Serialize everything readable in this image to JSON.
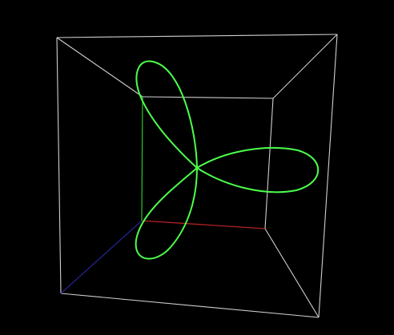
{
  "scene": {
    "background_color": "#000000",
    "box_edge_color": "#cfcfcf",
    "curve_color": "#4cff4c",
    "axes": {
      "x_color": "#b32222",
      "y_color": "#2cc82c",
      "z_color": "#22228f"
    },
    "curve": {
      "type": "rose",
      "petals": 3
    }
  }
}
